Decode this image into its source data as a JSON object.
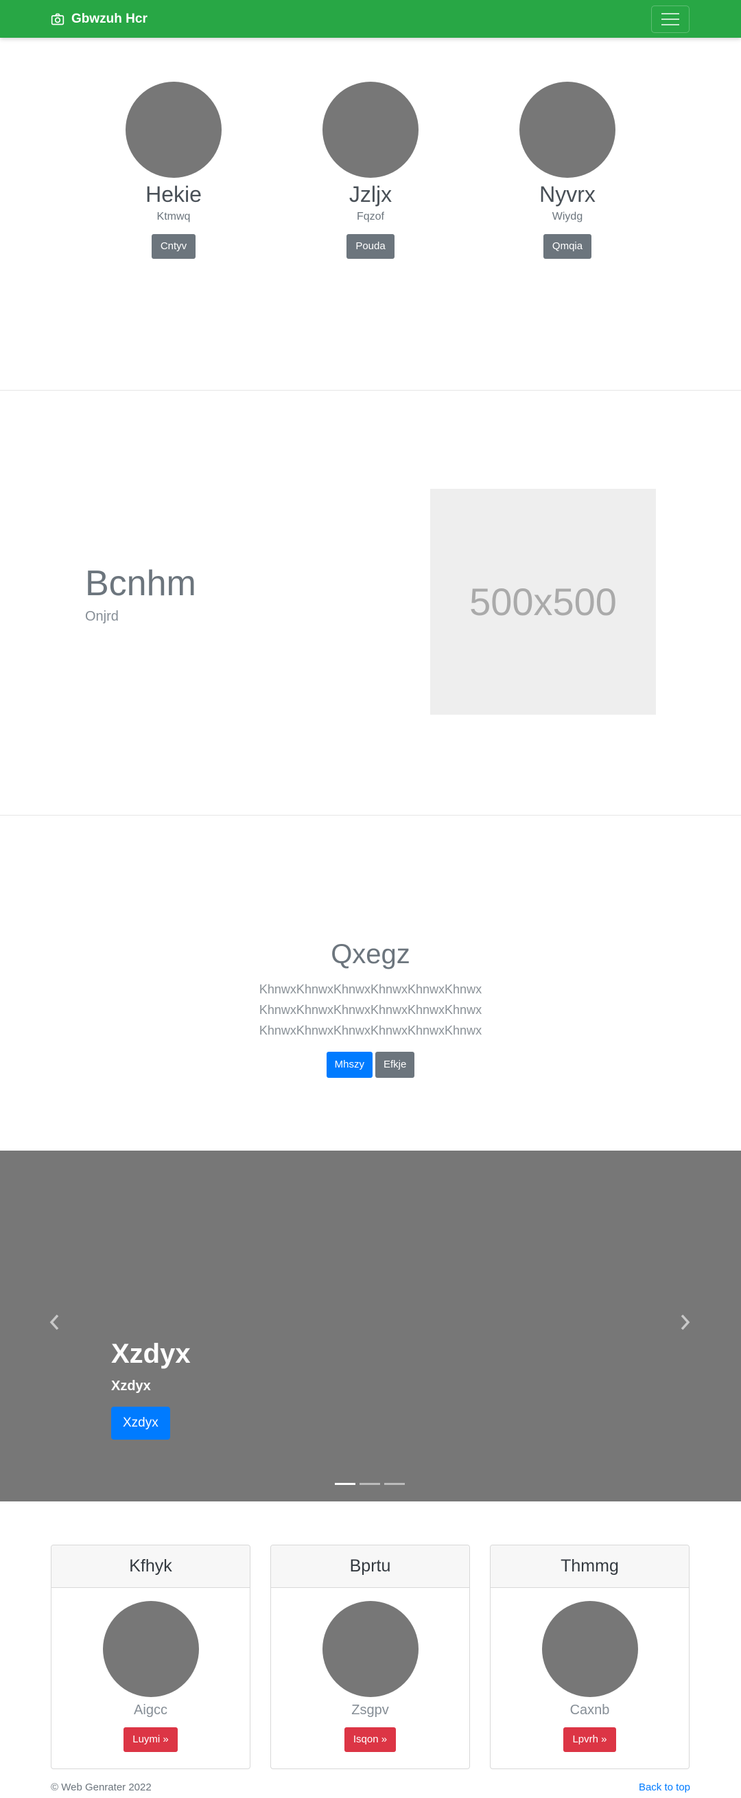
{
  "navbar": {
    "brand": "Gbwzuh Hcr",
    "brand_icon": "camera-icon",
    "toggler_icon": "hamburger-icon"
  },
  "profiles": [
    {
      "name": "Hekie",
      "sub": "Ktmwq",
      "button": "Cntyv"
    },
    {
      "name": "Jzljx",
      "sub": "Fqzof",
      "button": "Pouda"
    },
    {
      "name": "Nyvrx",
      "sub": "Wiydg",
      "button": "Qmqia"
    }
  ],
  "feature": {
    "title": "Bcnhm",
    "subtitle": "Onjrd",
    "placeholder_text": "500x500"
  },
  "jumbotron": {
    "title": "Qxegz",
    "lines": [
      "KhnwxKhnwxKhnwxKhnwxKhnwxKhnwx",
      "KhnwxKhnwxKhnwxKhnwxKhnwxKhnwx",
      "KhnwxKhnwxKhnwxKhnwxKhnwxKhnwx"
    ],
    "primary_button": "Mhszy",
    "secondary_button": "Efkje"
  },
  "carousel": {
    "title": "Xzdyx",
    "subtitle": "Xzdyx",
    "button": "Xzdyx",
    "prev_icon": "chevron-left-icon",
    "next_icon": "chevron-right-icon",
    "active_slide": 1,
    "slide_count": 3
  },
  "cards": [
    {
      "header": "Kfhyk",
      "sub": "Aigcc",
      "button": "Luymi »"
    },
    {
      "header": "Bprtu",
      "sub": "Zsgpv",
      "button": "Isqon »"
    },
    {
      "header": "Thmmg",
      "sub": "Caxnb",
      "button": "Lpvrh »"
    }
  ],
  "footer": {
    "copyright": "© Web Genrater 2022",
    "back_to_top": "Back to top"
  },
  "colors": {
    "navbar": "#28a745",
    "primary": "#007bff",
    "secondary": "#6c757d",
    "danger": "#dc3545",
    "placeholder_gray": "#777777"
  }
}
